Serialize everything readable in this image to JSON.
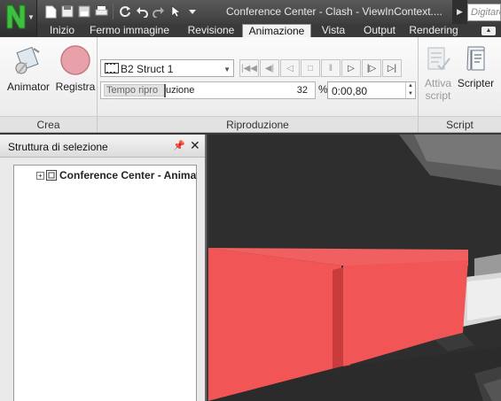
{
  "titlebar": {
    "window_title": "Conference Center - Clash - ViewInContext....",
    "search_placeholder": "Digitare",
    "app_icon": "navisworks-logo-icon",
    "quick_access": [
      "new-file-icon",
      "save-icon",
      "open-icon",
      "print-icon",
      "refresh-icon",
      "undo-icon",
      "redo-icon",
      "select-arrow-icon",
      "customize-dropdown-icon"
    ]
  },
  "tabs": [
    {
      "label": "Inizio",
      "active": false
    },
    {
      "label": "Fermo immagine",
      "active": false
    },
    {
      "label": "Revisione",
      "active": false
    },
    {
      "label": "Animazione",
      "active": true
    },
    {
      "label": "Vista",
      "active": false
    },
    {
      "label": "Output",
      "active": false
    },
    {
      "label": "Rendering",
      "active": false
    }
  ],
  "ribbon": {
    "crea": {
      "label": "Crea",
      "animator_label": "Animator",
      "registra_label": "Registra"
    },
    "riproduzione": {
      "label": "Riproduzione",
      "animation_select": "B2 Struct 1",
      "slider_label": "Tempo riproduzione",
      "slider_label_a": "Tempo ripro",
      "slider_label_b": "uzione",
      "slider_value": "32",
      "slider_fraction": 0.32,
      "percent_symbol": "%",
      "time_value": "0:00,80",
      "playback_buttons": [
        "rewind-start-icon",
        "step-back-icon",
        "play-reverse-icon",
        "stop-icon",
        "pause-icon",
        "play-icon",
        "step-forward-icon",
        "forward-end-icon"
      ]
    },
    "script": {
      "label": "Script",
      "attiva_line1": "Attiva",
      "attiva_line2": "script",
      "scripter_label": "Scripter"
    }
  },
  "panel": {
    "title": "Struttura di selezione",
    "tree_item": "Conference Center - Animat"
  },
  "colors": {
    "accent_red": "#f25555",
    "ribbon_bg": "#f3f3f3",
    "title_bg": "#3e3e3e"
  }
}
